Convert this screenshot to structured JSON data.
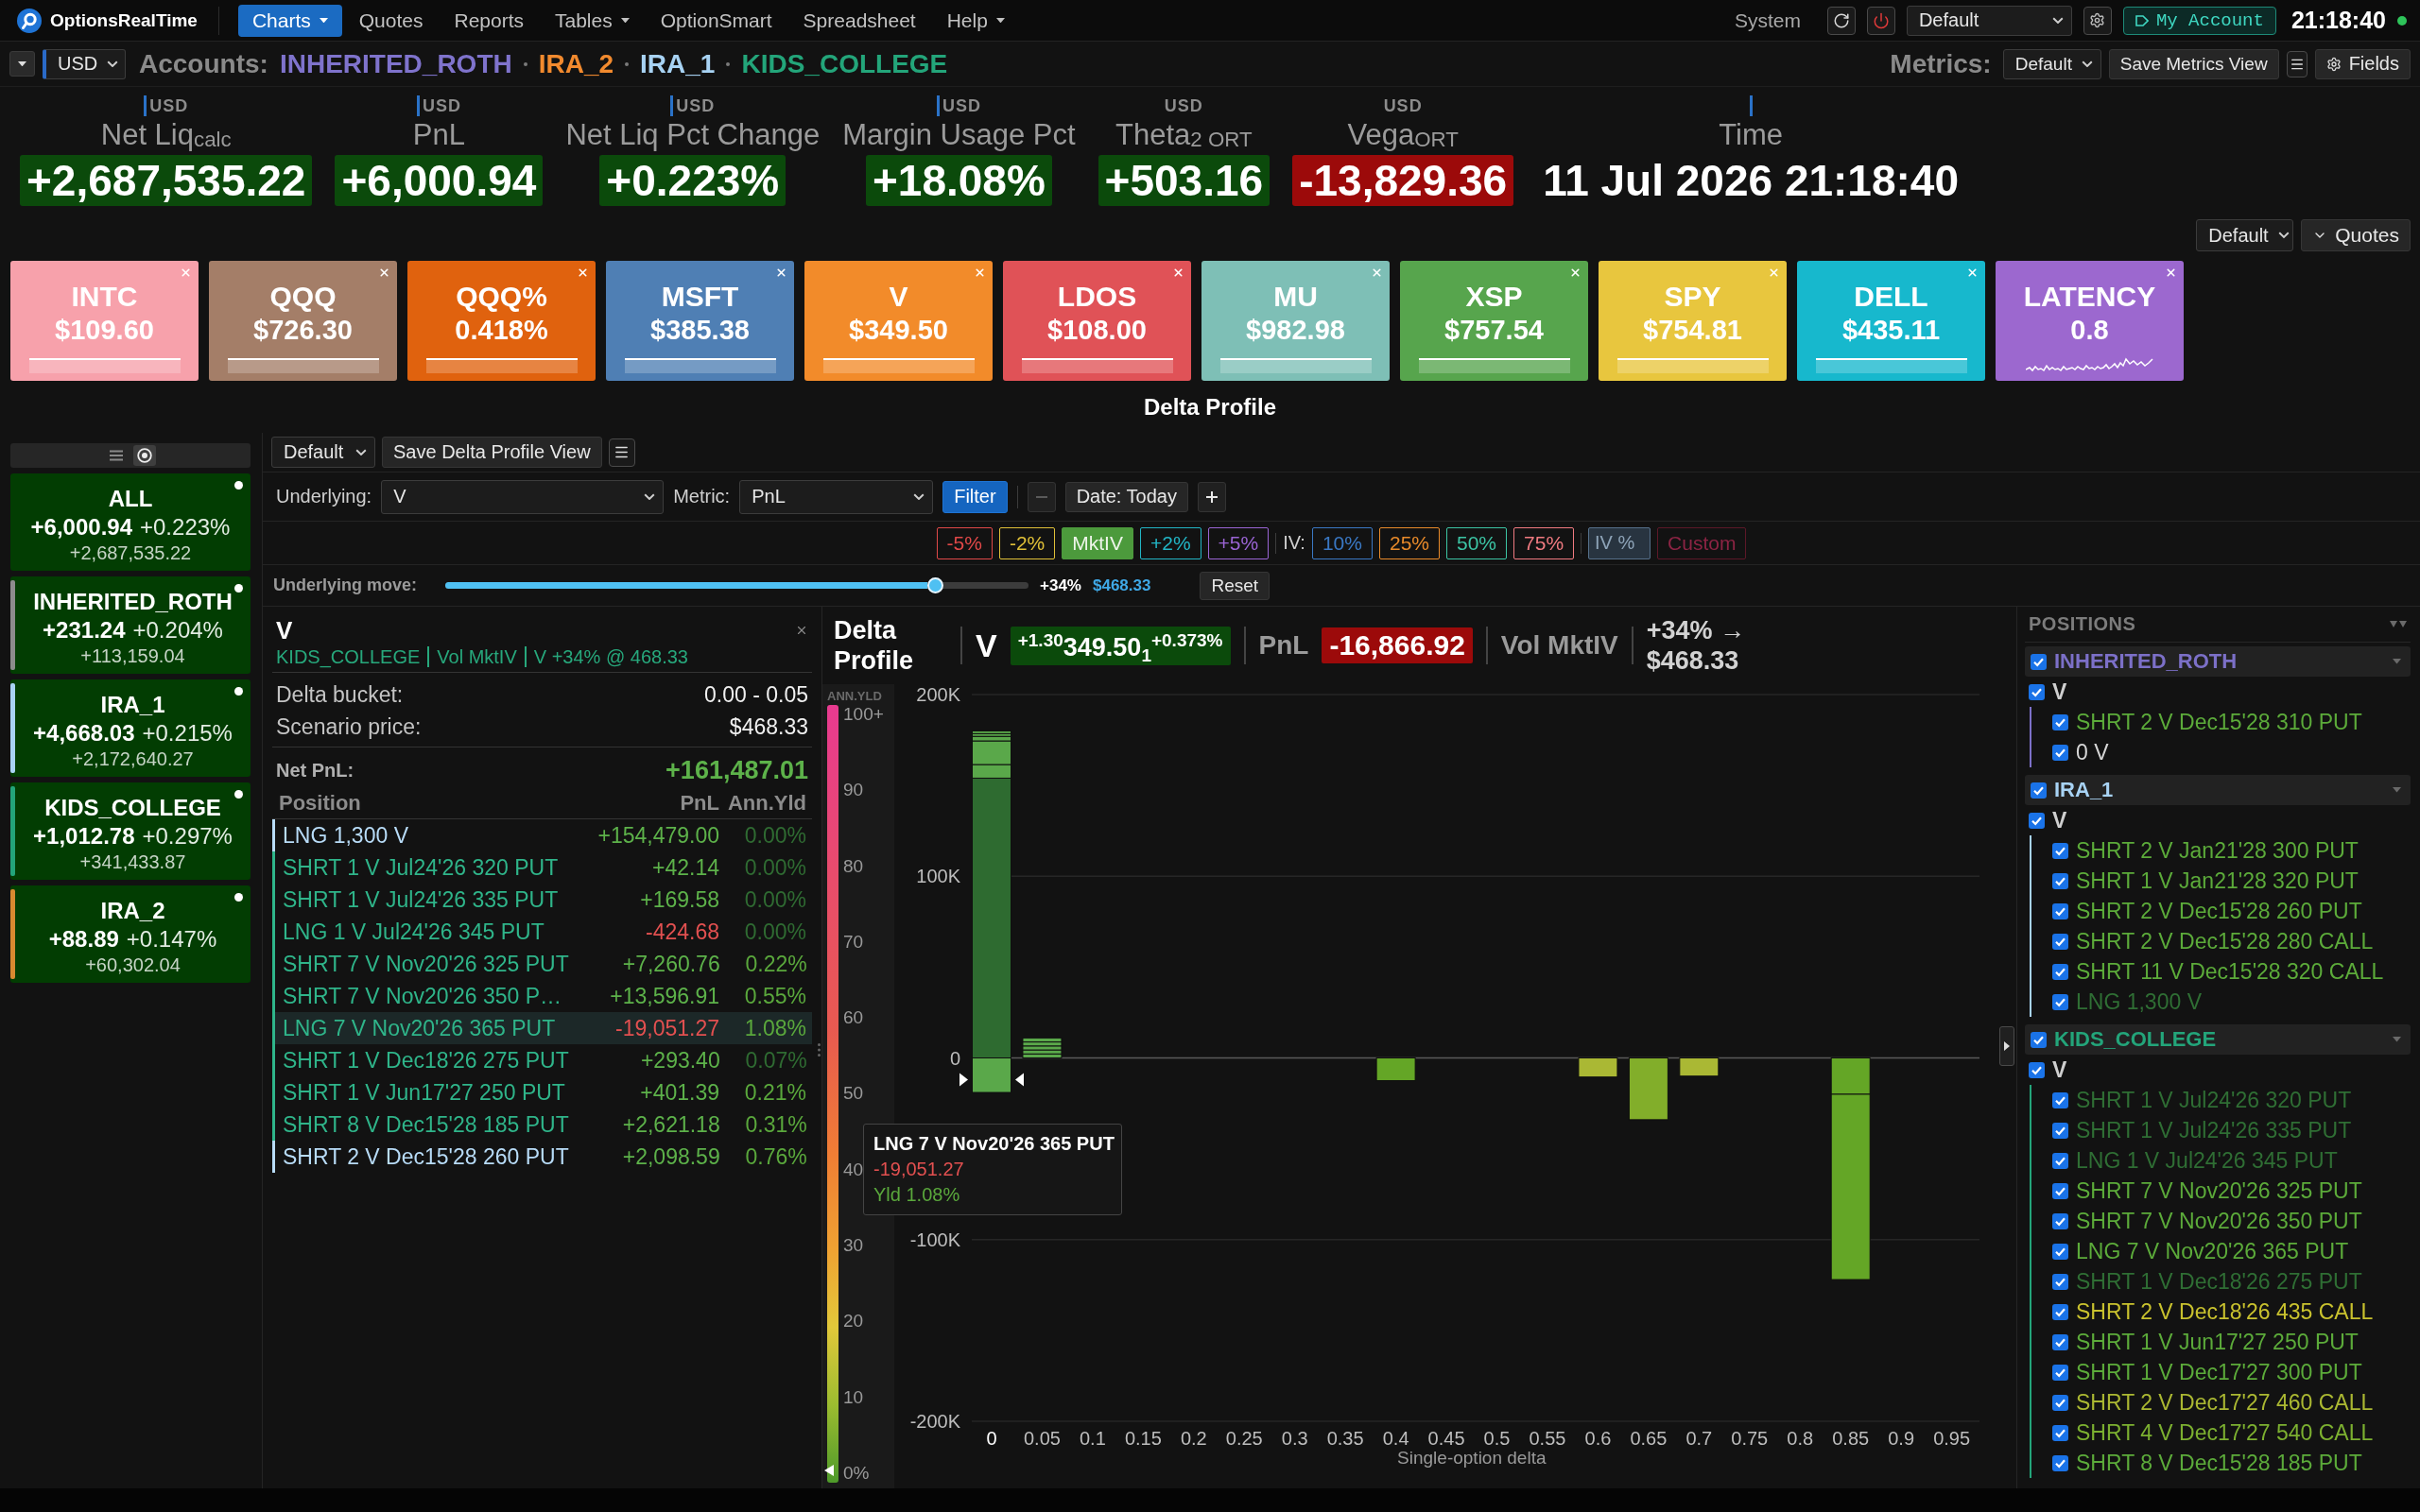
{
  "nav": {
    "brand": "OptionsRealTime",
    "menu": [
      {
        "label": "Charts",
        "selected": true,
        "dropdown": true
      },
      {
        "label": "Quotes",
        "selected": false,
        "dropdown": false
      },
      {
        "label": "Reports",
        "selected": false,
        "dropdown": false
      },
      {
        "label": "Tables",
        "selected": false,
        "dropdown": true
      },
      {
        "label": "OptionSmart",
        "selected": false,
        "dropdown": false
      },
      {
        "label": "Spreadsheet",
        "selected": false,
        "dropdown": false
      },
      {
        "label": "Help",
        "selected": false,
        "dropdown": true
      }
    ],
    "system_label": "System",
    "layout_select": "Default",
    "account_button": "My Account",
    "clock": "21:18:40"
  },
  "accounts_bar": {
    "currency": "USD",
    "label": "Accounts:",
    "accounts": [
      {
        "name": "INHERITED_ROTH",
        "color": "#7f73cc"
      },
      {
        "name": "IRA_2",
        "color": "#f28a2e"
      },
      {
        "name": "IRA_1",
        "color": "#a8d3f4"
      },
      {
        "name": "KIDS_COLLEGE",
        "color": "#23a57a"
      }
    ],
    "metrics_label": "Metrics:",
    "metrics_view": "Default",
    "save_button": "Save Metrics View",
    "fields_button": "Fields"
  },
  "metrics": [
    {
      "currency": "USD",
      "indicator": true,
      "label": "Net Liq$_{calc}$",
      "value": "+2,687,535.22",
      "kind": "positive"
    },
    {
      "currency": "USD",
      "indicator": true,
      "label": "PnL",
      "value": "+6,000.94",
      "kind": "positive"
    },
    {
      "currency": "USD",
      "indicator": true,
      "label": "Net Liq Pct Change",
      "value": "+0.223%",
      "kind": "positive"
    },
    {
      "currency": "USD",
      "indicator": true,
      "label": "Margin Usage Pct",
      "value": "+18.08%",
      "kind": "positive"
    },
    {
      "currency": "USD",
      "indicator": false,
      "label": "Theta$_{2 ORT}$",
      "value": "+503.16",
      "kind": "positive"
    },
    {
      "currency": "USD",
      "indicator": false,
      "label": "Vega$_{ORT}$",
      "value": "-13,829.36",
      "kind": "negative"
    },
    {
      "indicator": true,
      "label": "Time",
      "value": "11 Jul 2026 21:18:40",
      "kind": "plain"
    }
  ],
  "quotes_bar": {
    "view": "Default",
    "toggle": "Quotes"
  },
  "tiles": [
    {
      "symbol": "INTC",
      "price": "$109.60",
      "color": "#f7a1ab",
      "kind": "quote"
    },
    {
      "symbol": "QQQ",
      "price": "$726.30",
      "color": "#a47e68",
      "kind": "quote"
    },
    {
      "symbol": "QQQ%",
      "price": "0.418%",
      "color": "#e0620e",
      "kind": "quote"
    },
    {
      "symbol": "MSFT",
      "price": "$385.38",
      "color": "#4f7fb4",
      "kind": "quote"
    },
    {
      "symbol": "V",
      "price": "$349.50",
      "color": "#f28b2a",
      "kind": "quote"
    },
    {
      "symbol": "LDOS",
      "price": "$108.00",
      "color": "#e05257",
      "kind": "quote"
    },
    {
      "symbol": "MU",
      "price": "$982.98",
      "color": "#7ebfb6",
      "kind": "quote"
    },
    {
      "symbol": "XSP",
      "price": "$757.54",
      "color": "#57a54d",
      "kind": "quote"
    },
    {
      "symbol": "SPY",
      "price": "$754.81",
      "color": "#e8c63e",
      "kind": "quote"
    },
    {
      "symbol": "DELL",
      "price": "$435.11",
      "color": "#17b8cd",
      "kind": "quote"
    },
    {
      "symbol": "LATENCY",
      "price": "0.8",
      "color": "#9c68cf",
      "kind": "latency"
    }
  ],
  "section_title": "Delta Profile",
  "sidebar": {
    "views": [
      {
        "kind": "list",
        "selected": false
      },
      {
        "kind": "target",
        "selected": true
      }
    ],
    "cards": [
      {
        "name": "ALL",
        "pnl": "+6,000.94",
        "pct": "+0.223%",
        "net_liq": "+2,687,535.22"
      },
      {
        "name": "INHERITED_ROTH",
        "pnl": "+231.24",
        "pct": "+0.204%",
        "net_liq": "+113,159.04",
        "color": "#8c8c8c"
      },
      {
        "name": "IRA_1",
        "pnl": "+4,668.03",
        "pct": "+0.215%",
        "net_liq": "+2,172,640.27",
        "color": "#a8d3f4"
      },
      {
        "name": "KIDS_COLLEGE",
        "pnl": "+1,012.78",
        "pct": "+0.297%",
        "net_liq": "+341,433.87",
        "color": "#23a57a"
      },
      {
        "name": "IRA_2",
        "pnl": "+88.89",
        "pct": "+0.147%",
        "net_liq": "+60,302.04",
        "color": "#d88a30"
      }
    ]
  },
  "toolbar": {
    "view": "Default",
    "save_button": "Save Delta Profile View",
    "underlying_label": "Underlying:",
    "underlying": "V",
    "metric_label": "Metric:",
    "metric": "PnL",
    "filter_button": "Filter",
    "date_prev_disabled": true,
    "date_button": "Date: Today"
  },
  "scenarios": {
    "moves": [
      {
        "label": "-5%",
        "color": "#e04848",
        "selected": false
      },
      {
        "label": "-2%",
        "color": "#e0c038",
        "selected": false
      },
      {
        "label": "MktIV",
        "color": "#4c9a3c",
        "selected": true
      },
      {
        "label": "+2%",
        "color": "#22b5c5",
        "selected": false
      },
      {
        "label": "+5%",
        "color": "#9a64d4",
        "selected": false
      }
    ],
    "iv_label": "IV:",
    "iv_levels": [
      {
        "label": "10%",
        "color": "#3a78c4",
        "selected": false
      },
      {
        "label": "25%",
        "color": "#e88a2a",
        "selected": false
      },
      {
        "label": "50%",
        "color": "#3cc4a4",
        "selected": false
      },
      {
        "label": "75%",
        "color": "#f07a80",
        "selected": false
      }
    ],
    "iv_input": {
      "placeholder": "IV %"
    },
    "custom_button": {
      "label": "Custom",
      "disabled": true
    }
  },
  "move": {
    "label": "Underlying move:",
    "level": 0.84,
    "pct": "+34%",
    "price": "$468.33",
    "reset": "Reset"
  },
  "detail": {
    "title": "V",
    "context": [
      "KIDS_COLLEGE",
      "Vol MktIV",
      "V +34% @ 468.33"
    ],
    "facts": [
      {
        "label": "Delta bucket:",
        "value": "0.00 - 0.05"
      },
      {
        "label": "Scenario price:",
        "value": "$468.33"
      }
    ],
    "net_label": "Net PnL:",
    "net_value": "+161,487.01",
    "columns": [
      "Position",
      "PnL",
      "Ann.Yld"
    ],
    "rows": [
      {
        "position": "LNG 1,300 V",
        "pnl": "+154,479.00",
        "negative": false,
        "yld": {
          "text": "0.00%",
          "color": "#2f6b32"
        },
        "color": "#b8dcf8",
        "selected": false
      },
      {
        "position": "SHRT 1 V Jul24'26 320 PUT",
        "pnl": "+42.14",
        "negative": false,
        "yld": {
          "text": "0.00%",
          "color": "#2f6b32"
        },
        "color": "#2fb58a",
        "selected": false
      },
      {
        "position": "SHRT 1 V Jul24'26 335 PUT",
        "pnl": "+169.58",
        "negative": false,
        "yld": {
          "text": "0.00%",
          "color": "#2f6b32"
        },
        "color": "#2fb58a",
        "selected": false
      },
      {
        "position": "LNG 1 V Jul24'26 345 PUT",
        "pnl": "-424.68",
        "negative": true,
        "yld": {
          "text": "0.00%",
          "color": "#2f6b32"
        },
        "color": "#2fb58a",
        "selected": false
      },
      {
        "position": "SHRT 7 V Nov20'26 325 PUT",
        "pnl": "+7,260.76",
        "negative": false,
        "yld": {
          "text": "0.22%",
          "color": "#5aa83c"
        },
        "color": "#2fb58a",
        "selected": false
      },
      {
        "position": "SHRT 7 V Nov20'26 350 P…",
        "pnl": "+13,596.91",
        "negative": false,
        "yld": {
          "text": "0.55%",
          "color": "#5aa83c"
        },
        "color": "#2fb58a",
        "selected": false
      },
      {
        "position": "LNG 7 V Nov20'26 365 PUT",
        "pnl": "-19,051.27",
        "negative": true,
        "yld": {
          "text": "1.08%",
          "color": "#5aa83c"
        },
        "color": "#2fb58a",
        "selected": true
      },
      {
        "position": "SHRT 1 V Dec18'26 275 PUT",
        "pnl": "+293.40",
        "negative": false,
        "yld": {
          "text": "0.07%",
          "color": "#2f6b32"
        },
        "color": "#2fb58a",
        "selected": false
      },
      {
        "position": "SHRT 1 V Jun17'27 250 PUT",
        "pnl": "+401.39",
        "negative": false,
        "yld": {
          "text": "0.21%",
          "color": "#5aa83c"
        },
        "color": "#2fb58a",
        "selected": false
      },
      {
        "position": "SHRT 8 V Dec15'28 185 PUT",
        "pnl": "+2,621.18",
        "negative": false,
        "yld": {
          "text": "0.31%",
          "color": "#5aa83c"
        },
        "color": "#2fb58a",
        "selected": false
      },
      {
        "position": "SHRT 2 V Dec15'28 260 PUT",
        "pnl": "+2,098.59",
        "negative": false,
        "yld": {
          "text": "0.76%",
          "color": "#5aa83c"
        },
        "color": "#b8dcf8",
        "selected": false
      }
    ]
  },
  "chart": {
    "title": "Delta Profile",
    "symbol": "V",
    "quote": {
      "text": "$^{+1.30}$349.50$_{1}$$^{+0.373%}$",
      "kind": "positive"
    },
    "pnl": {
      "label": "PnL",
      "value": "-16,866.92",
      "kind": "negative"
    },
    "vol": "Vol MktIV",
    "move": "+34% →",
    "move_price": "$468.33",
    "yield_scale": {
      "label": "ANN.YLD",
      "ticks": [
        "100+",
        "90",
        "80",
        "70",
        "60",
        "50",
        "40",
        "30",
        "20",
        "10",
        "0%"
      ],
      "level": 0.0108
    },
    "buckets": [
      {
        "selected": true
      },
      {
        "selected": false
      },
      {
        "selected": false
      },
      {
        "selected": false
      },
      {
        "selected": false
      },
      {
        "selected": false
      },
      {
        "selected": false
      },
      {
        "selected": false
      },
      {
        "selected": false
      },
      {
        "selected": false
      },
      {
        "selected": false
      },
      {
        "selected": false
      },
      {
        "selected": false
      },
      {
        "selected": false
      },
      {
        "selected": false
      },
      {
        "selected": false
      },
      {
        "selected": false
      },
      {
        "selected": false
      },
      {
        "selected": false
      },
      {
        "selected": false
      }
    ],
    "tooltip": {
      "title": "LNG 7 V Nov20'26 365 PUT",
      "value": "-19,051.27",
      "negative": true,
      "yield": "Yld 1.08%"
    },
    "chart_data": {
      "type": "bar",
      "xlabel": "Single-option delta",
      "categories": [
        "0",
        "0.05",
        "0.1",
        "0.15",
        "0.2",
        "0.25",
        "0.3",
        "0.35",
        "0.4",
        "0.45",
        "0.5",
        "0.55",
        "0.6",
        "0.65",
        "0.7",
        "0.75",
        "0.8",
        "0.85",
        "0.9",
        "0.95"
      ],
      "stacked": true,
      "series": [
        {
          "color": "#2e6b30",
          "values": [
            154000,
            0,
            0,
            0,
            0,
            0,
            0,
            0,
            0,
            0,
            0,
            0,
            0,
            0,
            0,
            0,
            0,
            0,
            0,
            0
          ]
        },
        {
          "color": "#5aa84a",
          "values": [
            7500,
            2200,
            0,
            0,
            0,
            0,
            0,
            0,
            0,
            0,
            0,
            0,
            0,
            0,
            0,
            0,
            0,
            0,
            0,
            0
          ]
        },
        {
          "color": "#5aa84a",
          "values": [
            13000,
            2200,
            0,
            0,
            0,
            0,
            0,
            0,
            0,
            0,
            0,
            0,
            0,
            0,
            0,
            0,
            0,
            0,
            0,
            0
          ]
        },
        {
          "color": "#5aa84a",
          "values": [
            2500,
            2200,
            0,
            0,
            0,
            0,
            0,
            0,
            0,
            0,
            0,
            0,
            0,
            0,
            0,
            0,
            0,
            0,
            0,
            0
          ]
        },
        {
          "color": "#5aa84a",
          "values": [
            1500,
            2200,
            0,
            0,
            0,
            0,
            0,
            0,
            0,
            0,
            0,
            0,
            0,
            0,
            0,
            0,
            0,
            0,
            0,
            0
          ]
        },
        {
          "color": "#5aa84a",
          "values": [
            1500,
            2200,
            0,
            0,
            0,
            0,
            0,
            0,
            0,
            0,
            0,
            0,
            0,
            0,
            0,
            0,
            0,
            0,
            0,
            0
          ]
        },
        {
          "color": "#5aa84a",
          "values": [
            -19000,
            0,
            0,
            0,
            0,
            0,
            0,
            0,
            0,
            0,
            0,
            0,
            0,
            0,
            0,
            0,
            0,
            0,
            0,
            0
          ]
        },
        {
          "color": "#64a626",
          "values": [
            0,
            0,
            0,
            0,
            0,
            0,
            0,
            0,
            -12500,
            0,
            0,
            0,
            0,
            0,
            0,
            0,
            0,
            -20000,
            0,
            0
          ]
        },
        {
          "color": "#64a626",
          "values": [
            0,
            0,
            0,
            0,
            0,
            0,
            0,
            0,
            0,
            0,
            0,
            0,
            0,
            0,
            0,
            0,
            0,
            -102000,
            0,
            0
          ]
        },
        {
          "color": "#82ae2a",
          "values": [
            0,
            0,
            0,
            0,
            0,
            0,
            0,
            0,
            0,
            0,
            0,
            0,
            0,
            -34000,
            0,
            0,
            0,
            0,
            0,
            0
          ]
        },
        {
          "color": "#aab834",
          "values": [
            0,
            0,
            0,
            0,
            0,
            0,
            0,
            0,
            0,
            0,
            0,
            0,
            -10500,
            0,
            -10000,
            0,
            0,
            0,
            0,
            0
          ]
        }
      ],
      "ylim": [
        -200000,
        200000
      ],
      "yticks": [
        {
          "value": 200000,
          "label": "200K"
        },
        {
          "value": 100000,
          "label": "100K"
        },
        {
          "value": 0,
          "label": "0"
        },
        {
          "value": -100000,
          "label": "-100K"
        },
        {
          "value": -200000,
          "label": "-200K"
        }
      ]
    }
  },
  "positions": {
    "title": "POSITIONS",
    "accounts": [
      {
        "name": "INHERITED_ROTH",
        "color": "#7c70c8",
        "checked": true,
        "expanded": true,
        "children": [
          {
            "name": "V",
            "checked": true,
            "children": [
              {
                "name": "SHRT 2 V Dec15'28 310 PUT",
                "checked": true,
                "color": "#5cab3a"
              },
              {
                "name": "0 V",
                "checked": true,
                "color": "#d6d6d6"
              }
            ]
          }
        ]
      },
      {
        "name": "IRA_1",
        "color": "#a8d3f4",
        "checked": true,
        "expanded": true,
        "children": [
          {
            "name": "V",
            "checked": true,
            "children": [
              {
                "name": "SHRT 2 V Jan21'28 300 PUT",
                "checked": true,
                "color": "#5cab3a"
              },
              {
                "name": "SHRT 1 V Jan21'28 320 PUT",
                "checked": true,
                "color": "#5cab3a"
              },
              {
                "name": "SHRT 2 V Dec15'28 260 PUT",
                "checked": true,
                "color": "#5cab3a"
              },
              {
                "name": "SHRT 2 V Dec15'28 280 CALL",
                "checked": true,
                "color": "#5cab3a"
              },
              {
                "name": "SHRT 11 V Dec15'28 320 CALL",
                "checked": true,
                "color": "#5cab3a"
              },
              {
                "name": "LNG 1,300 V",
                "checked": true,
                "color": "#2f6e34"
              }
            ]
          }
        ]
      },
      {
        "name": "KIDS_COLLEGE",
        "color": "#23a57a",
        "checked": true,
        "expanded": true,
        "children": [
          {
            "name": "V",
            "checked": true,
            "children": [
              {
                "name": "SHRT 1 V Jul24'26 320 PUT",
                "checked": true,
                "color": "#2f6e34"
              },
              {
                "name": "SHRT 1 V Jul24'26 335 PUT",
                "checked": true,
                "color": "#2f6e34"
              },
              {
                "name": "LNG 1 V Jul24'26 345 PUT",
                "checked": true,
                "color": "#2f6e34"
              },
              {
                "name": "SHRT 7 V Nov20'26 325 PUT",
                "checked": true,
                "color": "#5cab3a"
              },
              {
                "name": "SHRT 7 V Nov20'26 350 PUT",
                "checked": true,
                "color": "#5cab3a"
              },
              {
                "name": "LNG 7 V Nov20'26 365 PUT",
                "checked": true,
                "color": "#5cab3a"
              },
              {
                "name": "SHRT 1 V Dec18'26 275 PUT",
                "checked": true,
                "color": "#2f6e34"
              },
              {
                "name": "SHRT 2 V Dec18'26 435 CALL",
                "checked": true,
                "color": "#c9c22e"
              },
              {
                "name": "SHRT 1 V Jun17'27 250 PUT",
                "checked": true,
                "color": "#5cab3a"
              },
              {
                "name": "SHRT 1 V Dec17'27 300 PUT",
                "checked": true,
                "color": "#5cab3a"
              },
              {
                "name": "SHRT 2 V Dec17'27 460 CALL",
                "checked": true,
                "color": "#abb832"
              },
              {
                "name": "SHRT 4 V Dec17'27 540 CALL",
                "checked": true,
                "color": "#7cb030"
              },
              {
                "name": "SHRT 8 V Dec15'28 185 PUT",
                "checked": true,
                "color": "#5cab3a"
              }
            ]
          }
        ]
      }
    ]
  }
}
